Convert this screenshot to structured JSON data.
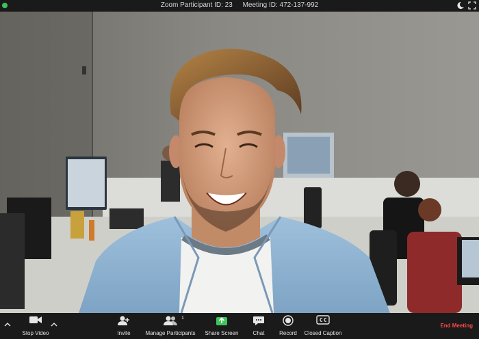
{
  "window": {
    "participant_id_label": "Zoom Participant ID: 23",
    "meeting_id_label": "Meeting ID: 472-137-992"
  },
  "toolbar": {
    "stop_video": "Stop Video",
    "invite": "Invite",
    "manage_participants": "Manage Participants",
    "participant_count": "1",
    "share_screen": "Share Screen",
    "chat": "Chat",
    "record": "Record",
    "closed_caption": "Closed Caption",
    "end_meeting": "End Meeting"
  },
  "colors": {
    "status_online": "#3cc45a",
    "share_screen_accent": "#3cc45a",
    "end_meeting": "#ff4a4a",
    "toolbar_bg": "#1a1a1a"
  },
  "icons": {
    "status": "green-dot-icon",
    "theme": "moon-icon",
    "fullscreen": "fullscreen-icon",
    "video": "video-camera-icon",
    "invite": "add-person-icon",
    "participants": "people-icon",
    "share": "share-arrow-icon",
    "chat": "chat-bubble-icon",
    "record": "record-icon",
    "cc": "closed-caption-icon"
  }
}
